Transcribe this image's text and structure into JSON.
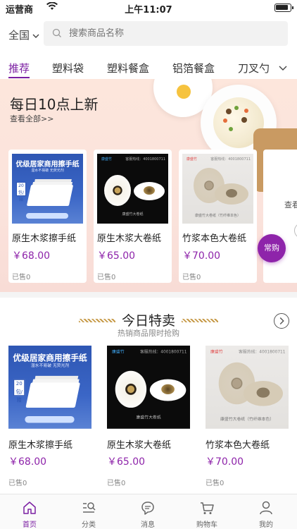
{
  "status_bar": {
    "carrier": "运营商",
    "time": "上午11:07"
  },
  "search": {
    "region": "全国",
    "placeholder": "搜索商品名称"
  },
  "tabs": [
    {
      "label": "推荐",
      "active": true
    },
    {
      "label": "塑料袋",
      "active": false
    },
    {
      "label": "塑料餐盒",
      "active": false
    },
    {
      "label": "铝箔餐盒",
      "active": false
    },
    {
      "label": "刀叉勺",
      "active": false
    }
  ],
  "new_arrivals": {
    "title": "每日10点上新",
    "view_all": "查看全部>>",
    "peek_label": "查看",
    "products": [
      {
        "name": "原生木浆擦手纸",
        "price": "￥68.00",
        "sold": "已售0"
      },
      {
        "name": "原生木浆大卷纸",
        "price": "￥65.00",
        "sold": "已售0"
      },
      {
        "name": "竹浆本色大卷纸",
        "price": "￥70.00",
        "sold": "已售0"
      }
    ]
  },
  "float_button": {
    "label": "常购"
  },
  "today_special": {
    "title": "今日特卖",
    "subtitle": "热销商品限时抢购",
    "products": [
      {
        "name": "原生木浆擦手纸",
        "price": "￥68.00",
        "sold": "已售0"
      },
      {
        "name": "原生木浆大卷纸",
        "price": "￥65.00",
        "sold": "已售0"
      },
      {
        "name": "竹浆本色大卷纸",
        "price": "￥70.00",
        "sold": "已售0"
      }
    ]
  },
  "product_images": {
    "towel": {
      "header": "优级居家商用擦手纸",
      "subheader": "湿水不易破 无荧光剂",
      "count_badge": "20包/箱"
    },
    "roll_dark": {
      "brand": "康盛竹",
      "hotline": "客服热线：4001800711",
      "caption": "康盛竹大卷纸"
    },
    "roll_light": {
      "brand": "康盛竹",
      "hotline": "客服热线：4001800711",
      "caption": "康盛竹大卷纸（竹纤维本色）"
    }
  },
  "tab_bar": [
    {
      "label": "首页",
      "icon": "home-icon",
      "active": true
    },
    {
      "label": "分类",
      "icon": "category-icon",
      "active": false
    },
    {
      "label": "消息",
      "icon": "message-icon",
      "active": false
    },
    {
      "label": "购物车",
      "icon": "cart-icon",
      "active": false
    },
    {
      "label": "我的",
      "icon": "profile-icon",
      "active": false
    }
  ],
  "colors": {
    "accent": "#7b1fa2",
    "price": "#8e24aa",
    "banner_bg": "#fde6dc"
  }
}
